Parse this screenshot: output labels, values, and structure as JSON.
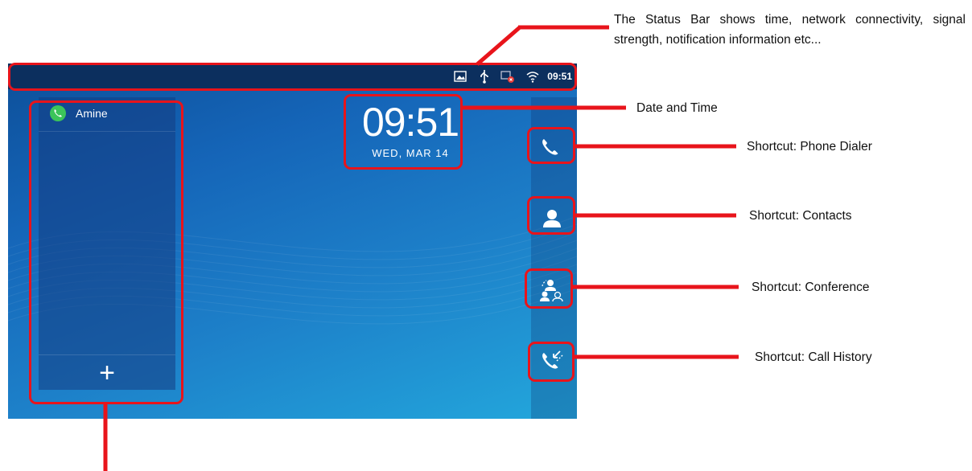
{
  "status_bar": {
    "time": "09:51",
    "icons": [
      "image-icon",
      "usb-icon",
      "network-error-icon",
      "wifi-icon"
    ]
  },
  "account": {
    "name": "Amine",
    "add_label": "+"
  },
  "clock": {
    "time": "09:51",
    "date": "WED, MAR 14"
  },
  "shortcuts": [
    "phone-dialer-icon",
    "contacts-icon",
    "conference-icon",
    "call-history-icon"
  ],
  "annotations": {
    "status_bar": "The Status Bar shows time, network connectivity, signal strength, notification information etc...",
    "date_time": "Date and Time",
    "phone_dialer": "Shortcut: Phone Dialer",
    "contacts": "Shortcut: Contacts",
    "conference": "Shortcut: Conference",
    "call_history": "Shortcut: Call History"
  },
  "colors": {
    "annotation": "#e8141b",
    "status_bar": "#0c2f5e",
    "account_dot": "#3cc45a"
  }
}
